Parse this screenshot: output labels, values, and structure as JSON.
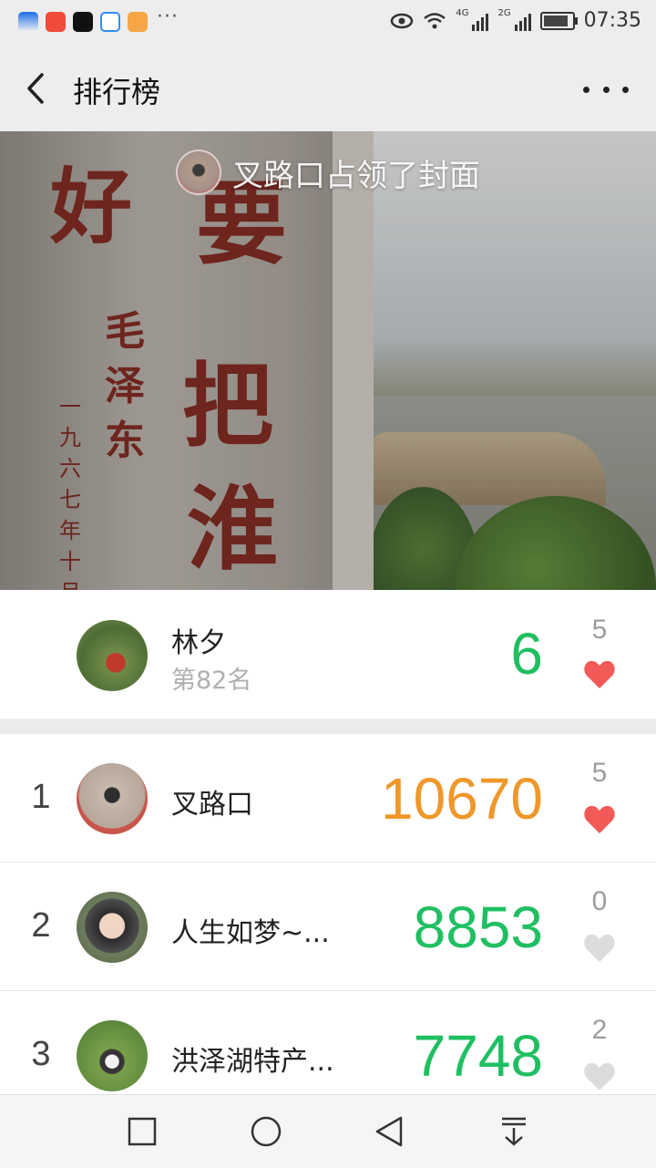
{
  "status_bar": {
    "time": "07:35",
    "network_1": "4G",
    "network_2": "2G",
    "overflow": "···",
    "app_icons": [
      "app-icon-blue",
      "app-icon-red",
      "douyin-icon",
      "cloud-icon",
      "video-icon"
    ]
  },
  "header": {
    "title": "排行榜",
    "back_icon": "chevron-left-icon",
    "more_icon": "more-horizontal-icon"
  },
  "cover": {
    "banner_text": "叉路口占领了封面"
  },
  "my_rank": {
    "name": "林夕",
    "rank_text": "第82名",
    "steps": "6",
    "likes": "5",
    "liked": true
  },
  "rankings": [
    {
      "rank": "1",
      "name": "叉路口",
      "steps": "10670",
      "likes": "5",
      "liked": true,
      "steps_color": "#f0972a"
    },
    {
      "rank": "2",
      "name": "人生如梦~...",
      "steps": "8853",
      "likes": "0",
      "liked": false,
      "steps_color": "#1fbf62"
    },
    {
      "rank": "3",
      "name": "洪泽湖特产...",
      "steps": "7748",
      "likes": "2",
      "liked": false,
      "steps_color": "#1fbf62"
    }
  ],
  "colors": {
    "green": "#1fbf62",
    "orange": "#f0972a",
    "heart_red": "#f25a57",
    "heart_gray": "#dcdcdc"
  },
  "nav_bar": {
    "icons": [
      "recent-apps-icon",
      "home-icon",
      "back-triangle-icon",
      "notification-pulldown-icon"
    ]
  }
}
